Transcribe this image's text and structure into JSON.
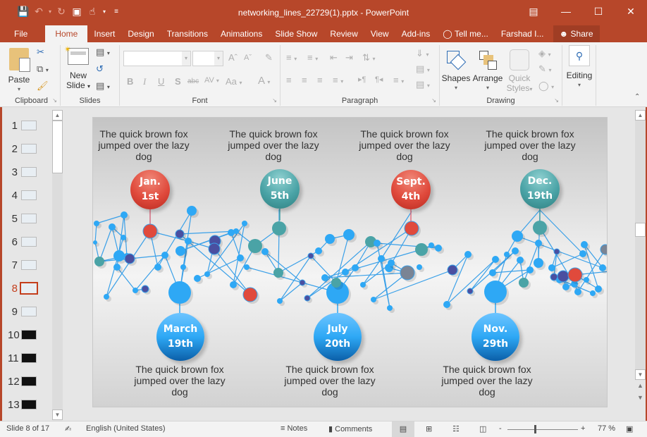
{
  "window": {
    "title": "networking_lines_22729(1).pptx - PowerPoint",
    "controls": [
      "ribbon-display-options",
      "minimize",
      "maximize",
      "close"
    ]
  },
  "quick_access": [
    "save-icon",
    "undo-icon",
    "redo-icon",
    "present-from-beginning-icon",
    "touch-mode-icon",
    "customize-qat-icon"
  ],
  "tabs": [
    {
      "label": "File"
    },
    {
      "label": "Home",
      "active": true
    },
    {
      "label": "Insert"
    },
    {
      "label": "Design"
    },
    {
      "label": "Transitions"
    },
    {
      "label": "Animations"
    },
    {
      "label": "Slide Show"
    },
    {
      "label": "Review"
    },
    {
      "label": "View"
    },
    {
      "label": "Add-ins"
    },
    {
      "label": "Tell me..."
    },
    {
      "label": "Farshad I..."
    },
    {
      "label": "Share"
    }
  ],
  "ribbon": {
    "clipboard": {
      "label": "Clipboard",
      "paste": "Paste"
    },
    "slides": {
      "label": "Slides",
      "new_slide_1": "New",
      "new_slide_2": "Slide"
    },
    "font": {
      "label": "Font",
      "font_name": "",
      "font_size": ""
    },
    "paragraph": {
      "label": "Paragraph"
    },
    "drawing": {
      "label": "Drawing",
      "shapes": "Shapes",
      "arrange": "Arrange",
      "quick_styles_1": "Quick",
      "quick_styles_2": "Styles"
    },
    "editing": {
      "label": "Editing"
    }
  },
  "slides_pane": {
    "selected": 8,
    "thumbnails": [
      {
        "num": "1"
      },
      {
        "num": "2"
      },
      {
        "num": "3"
      },
      {
        "num": "4"
      },
      {
        "num": "5"
      },
      {
        "num": "6"
      },
      {
        "num": "7"
      },
      {
        "num": "8"
      },
      {
        "num": "9"
      },
      {
        "num": "10"
      },
      {
        "num": "11"
      },
      {
        "num": "12"
      },
      {
        "num": "13"
      }
    ]
  },
  "slide": {
    "top_events": [
      {
        "date_line1": "Jan.",
        "date_line2": "1st",
        "color": "#e04a3c",
        "caption": "The quick brown fox jumped over the lazy dog"
      },
      {
        "date_line1": "June",
        "date_line2": "5th",
        "color": "#4aa3a6",
        "caption": "The quick brown fox jumped over the lazy dog"
      },
      {
        "date_line1": "Sept.",
        "date_line2": "4th",
        "color": "#e04a3c",
        "caption": "The quick brown fox jumped over the lazy dog"
      },
      {
        "date_line1": "Dec.",
        "date_line2": "19th",
        "color": "#4aa3a6",
        "caption": "The quick brown fox jumped over the lazy dog"
      }
    ],
    "bottom_events": [
      {
        "date_line1": "March",
        "date_line2": "19th",
        "color": "#2196f3",
        "caption": "The quick brown fox jumped over the lazy dog"
      },
      {
        "date_line1": "July",
        "date_line2": "20th",
        "color": "#2196f3",
        "caption": "The quick brown fox jumped over the lazy dog"
      },
      {
        "date_line1": "Nov.",
        "date_line2": "29th",
        "color": "#2196f3",
        "caption": "The quick brown fox jumped over the lazy dog"
      }
    ],
    "network_colors": {
      "line": "#3aa0e8",
      "node_blue": "#2ea8f5",
      "node_teal": "#4aa3a6",
      "node_navy": "#4a4fa0",
      "node_red": "#e04a3c",
      "node_gray": "#7a8494"
    }
  },
  "status": {
    "slide_info": "Slide 8 of 17",
    "language": "English (United States)",
    "notes": "Notes",
    "comments": "Comments",
    "zoom": "77 %",
    "zoom_level": 0.77
  },
  "colors": {
    "accent": "#b7472a",
    "ribbon_bg": "#f3f3f3"
  }
}
